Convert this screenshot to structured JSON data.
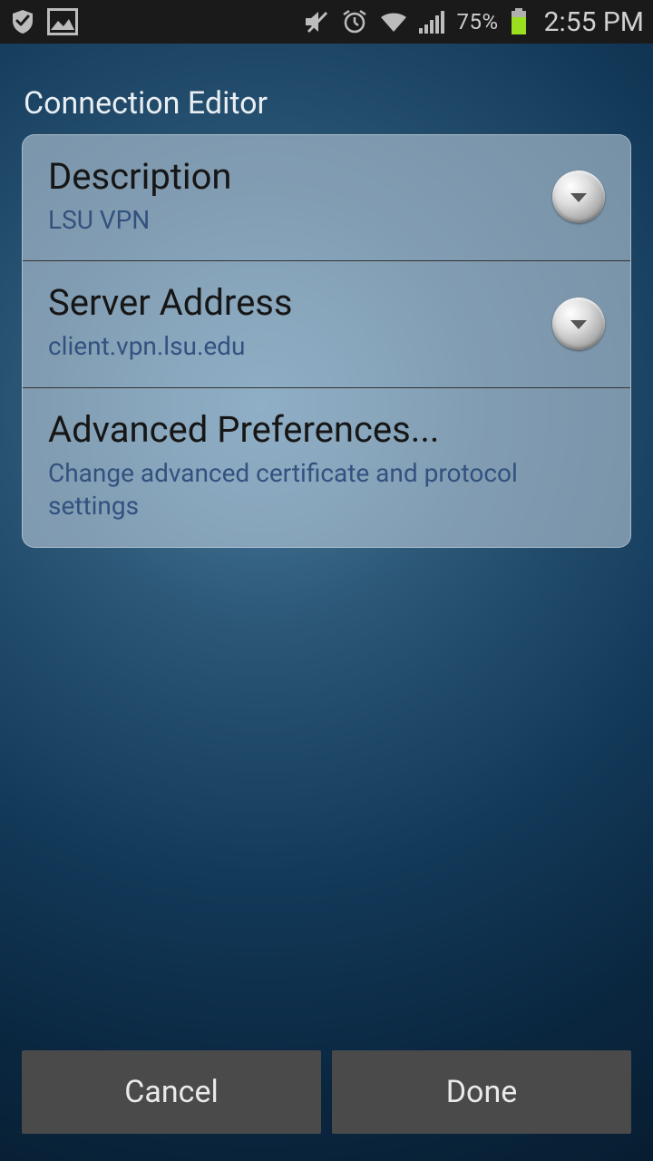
{
  "status": {
    "battery_pct": "75%",
    "clock": "2:55 PM"
  },
  "title": "Connection Editor",
  "rows": {
    "description": {
      "title": "Description",
      "value": "LSU VPN"
    },
    "server": {
      "title": "Server Address",
      "value": "client.vpn.lsu.edu"
    },
    "advanced": {
      "title": "Advanced Preferences...",
      "sub": "Change advanced certificate and protocol settings"
    }
  },
  "buttons": {
    "cancel": "Cancel",
    "done": "Done"
  }
}
